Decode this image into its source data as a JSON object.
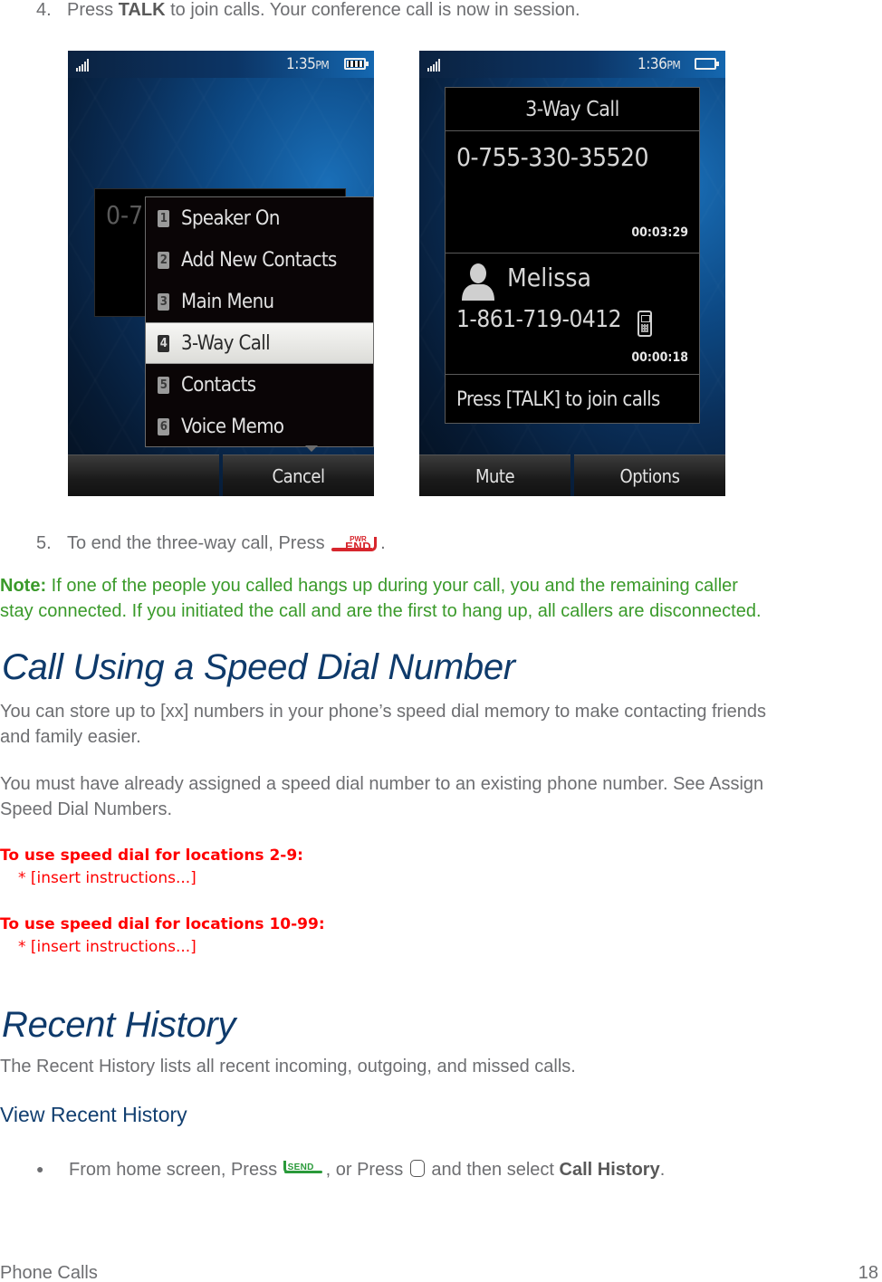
{
  "step4": {
    "number": "4.",
    "pre": "Press ",
    "bold": "TALK",
    "post": " to join calls. Your conference call is now in session."
  },
  "screen_left": {
    "time": "1:35",
    "ampm": "PM",
    "battery": "full",
    "background_number_partial": "0-75",
    "menu_items": [
      {
        "key": "1",
        "label": "Speaker On"
      },
      {
        "key": "2",
        "label": "Add New Contacts"
      },
      {
        "key": "3",
        "label": "Main Menu"
      },
      {
        "key": "4",
        "label": "3-Way Call",
        "selected": true
      },
      {
        "key": "5",
        "label": "Contacts"
      },
      {
        "key": "6",
        "label": "Voice Memo"
      }
    ],
    "softkeys": [
      "",
      "Cancel"
    ]
  },
  "screen_right": {
    "time": "1:36",
    "ampm": "PM",
    "battery": "empty",
    "title": "3-Way Call",
    "call1": {
      "number": "0-755-330-35520",
      "timer": "00:03:29"
    },
    "call2": {
      "name": "Melissa",
      "number": "1-861-719-0412",
      "timer": "00:00:18",
      "type_icon": "mobile-phone-icon"
    },
    "footer": "Press [TALK] to join calls",
    "softkeys": [
      "Mute",
      "Options"
    ]
  },
  "step5": {
    "number": "5.",
    "pre": "To end the three-way call, Press ",
    "post": ".",
    "key_icon": {
      "top": "PWR",
      "label": "END",
      "color": "#d7262d"
    }
  },
  "note": {
    "label": "Note:",
    "line1": " If one of the people you called hangs up during your call, you and the remaining caller",
    "line2": "stay connected. If you initiated the call and are the first to hang up, all callers are disconnected.",
    "color": "#3a9a2a"
  },
  "section_speed_dial": {
    "heading": "Call Using a Speed Dial Number",
    "para1_line1": "You can store up to [xx] numbers in your phone’s speed dial memory to make contacting friends",
    "para1_line2": "and family easier.",
    "para2_line1": "You must have already assigned a speed dial number to an existing phone number. See Assign",
    "para2_line2": "Speed Dial Numbers.",
    "placeholders": [
      {
        "heading": "To use speed dial for locations 2-9:",
        "text": "* [insert instructions...]"
      },
      {
        "heading": "To use speed dial for locations 10-99:",
        "text": "* [insert instructions...]"
      }
    ]
  },
  "section_recent": {
    "heading": "Recent History",
    "para": "The Recent History lists all recent incoming, outgoing, and missed calls.",
    "subheading": "View Recent History",
    "bullet": {
      "pre": "From home screen, Press ",
      "mid": ", or Press ",
      "post_pre": " and then select ",
      "bold": "Call History",
      "end": ".",
      "send_key_label": "SEND"
    }
  },
  "footer": {
    "chapter": "Phone Calls",
    "page": "18"
  },
  "colors": {
    "heading": "#0e3a6b",
    "body": "#6d6e71",
    "placeholder_red": "#ff0000",
    "send_green": "#2a9a3a"
  }
}
